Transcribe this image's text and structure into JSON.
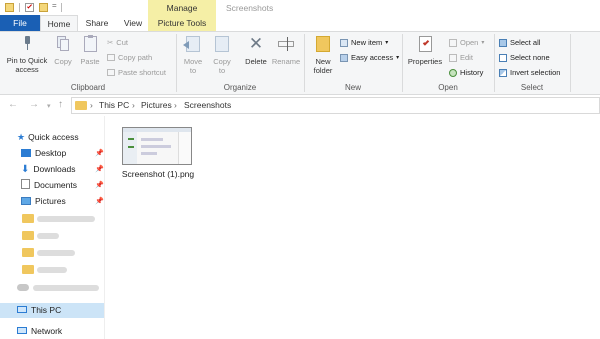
{
  "window": {
    "title": "Screenshots",
    "context_tab_group": "Manage"
  },
  "tabs": {
    "file": "File",
    "home": "Home",
    "share": "Share",
    "view": "View",
    "picture_tools": "Picture Tools"
  },
  "ribbon": {
    "clipboard": {
      "pin": "Pin to Quick access",
      "copy": "Copy",
      "paste": "Paste",
      "cut": "Cut",
      "copy_path": "Copy path",
      "paste_shortcut": "Paste shortcut",
      "group": "Clipboard"
    },
    "organize": {
      "move_to": "Move to",
      "copy_to": "Copy to",
      "delete": "Delete",
      "rename": "Rename",
      "group": "Organize"
    },
    "new": {
      "new_folder": "New folder",
      "new_item": "New item",
      "easy_access": "Easy access",
      "group": "New"
    },
    "open": {
      "properties": "Properties",
      "open": "Open",
      "edit": "Edit",
      "history": "History",
      "group": "Open"
    },
    "select": {
      "select_all": "Select all",
      "select_none": "Select none",
      "invert": "Invert selection",
      "group": "Select"
    }
  },
  "address": {
    "crumbs": [
      "This PC",
      "Pictures",
      "Screenshots"
    ],
    "sep": "›"
  },
  "sidebar": {
    "quick_access": "Quick access",
    "items": [
      "Desktop",
      "Downloads",
      "Documents",
      "Pictures"
    ],
    "this_pc": "This PC",
    "network": "Network"
  },
  "files": [
    {
      "name": "Screenshot (1).png"
    }
  ],
  "colors": {
    "accent": "#1a5fb4",
    "selection": "#cce4f7",
    "manage": "#f5efa6"
  }
}
